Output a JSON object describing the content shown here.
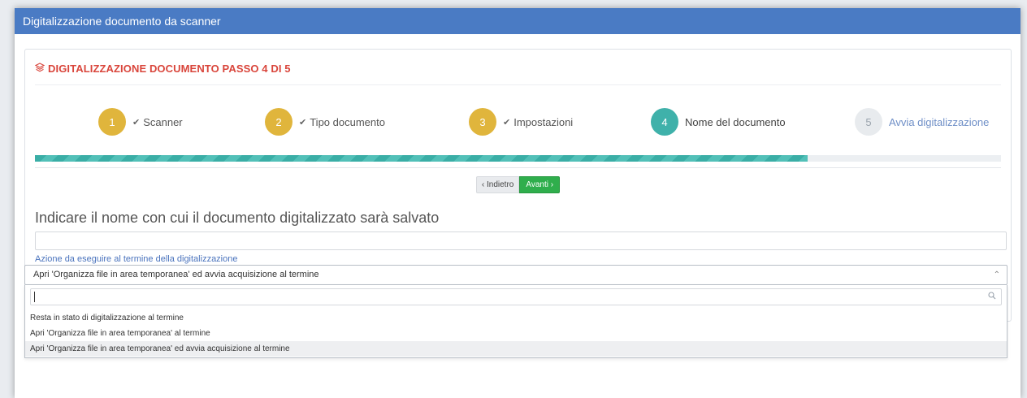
{
  "window": {
    "title": "Digitalizzazione documento da scanner"
  },
  "panel": {
    "heading": "DIGITALIZZAZIONE DOCUMENTO PASSO 4 DI 5",
    "heading_icon": "layers-icon"
  },
  "steps": [
    {
      "number": "1",
      "label": "Scanner",
      "state": "done"
    },
    {
      "number": "2",
      "label": "Tipo documento",
      "state": "done"
    },
    {
      "number": "3",
      "label": "Impostazioni",
      "state": "done"
    },
    {
      "number": "4",
      "label": "Nome del documento",
      "state": "active"
    },
    {
      "number": "5",
      "label": "Avvia digitalizzazione",
      "state": "todo"
    }
  ],
  "progress": {
    "fraction": 0.8
  },
  "nav": {
    "back_label": "‹ Indietro",
    "next_label": "Avanti ›"
  },
  "form": {
    "question": "Indicare il nome con cui il documento digitalizzato sarà salvato",
    "name_value": "",
    "action_label": "Azione da eseguire al termine della digitalizzazione",
    "action_selected": "Apri 'Organizza file in area temporanea' ed avvia acquisizione al termine",
    "search_value": "",
    "options": [
      "Resta in stato di digitalizzazione al termine",
      "Apri 'Organizza file in area temporanea' al termine",
      "Apri 'Organizza file in area temporanea' ed avvia acquisizione al termine"
    ]
  },
  "colors": {
    "title_bar": "#4a7bc4",
    "heading": "#d9453b",
    "step_done": "#e0b53c",
    "step_active": "#3fb1aa",
    "next_button": "#2fae4c"
  }
}
